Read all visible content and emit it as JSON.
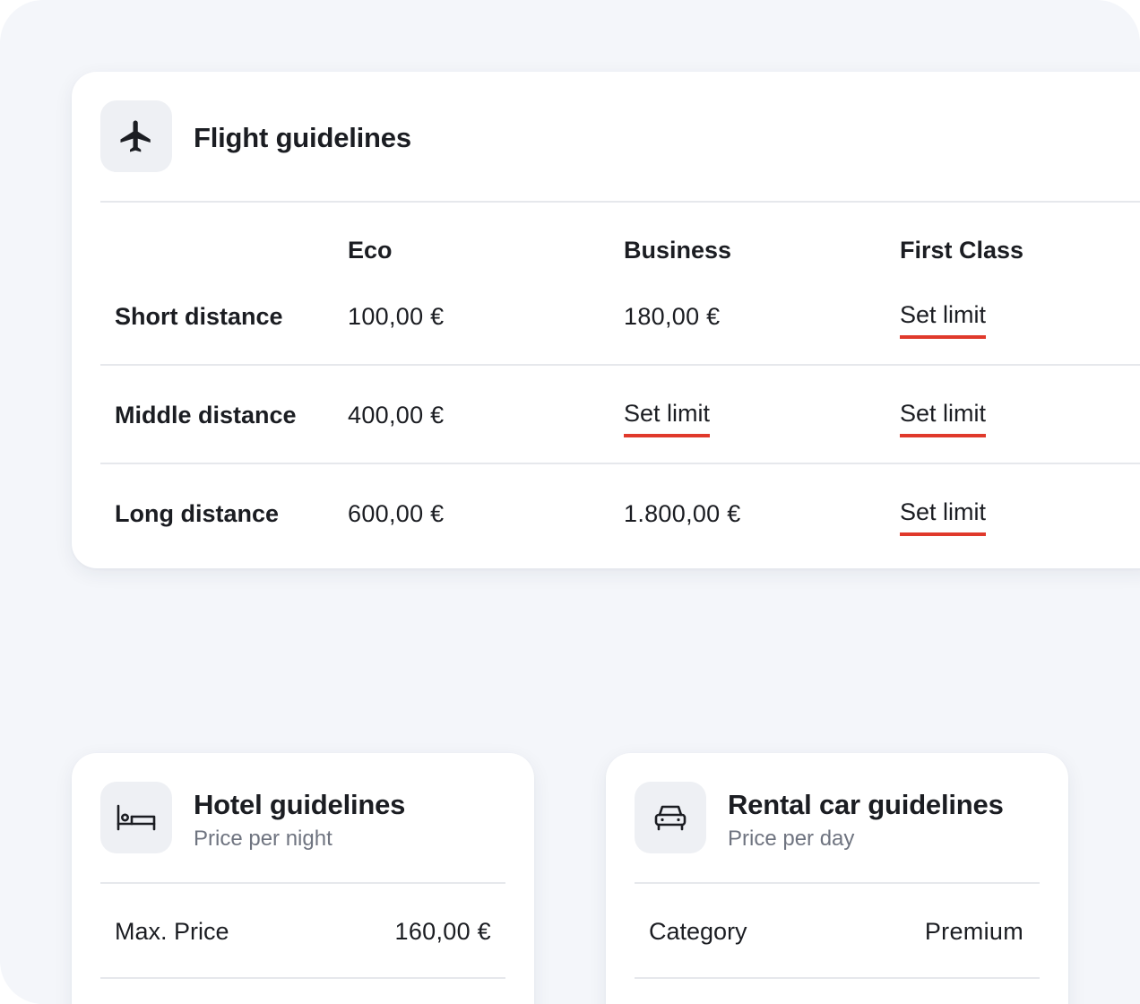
{
  "flight": {
    "title": "Flight guidelines",
    "icon": "airplane-icon",
    "columns": [
      "Eco",
      "Business",
      "First Class"
    ],
    "rows": [
      {
        "label": "Short distance",
        "cells": [
          "100,00 €",
          "180,00 €",
          "Set limit"
        ]
      },
      {
        "label": "Middle distance",
        "cells": [
          "400,00 €",
          "Set limit",
          "Set limit"
        ]
      },
      {
        "label": "Long distance",
        "cells": [
          "600,00 €",
          "1.800,00 €",
          "Set limit"
        ]
      }
    ],
    "link_color": "#e0392b"
  },
  "hotel": {
    "title": "Hotel guidelines",
    "subtitle": "Price per night",
    "icon": "bed-icon",
    "rows": [
      {
        "label": "Max. Price",
        "value": "160,00 €"
      }
    ]
  },
  "car": {
    "title": "Rental car guidelines",
    "subtitle": "Price per day",
    "icon": "car-icon",
    "rows": [
      {
        "label": "Category",
        "value": "Premium"
      }
    ]
  }
}
